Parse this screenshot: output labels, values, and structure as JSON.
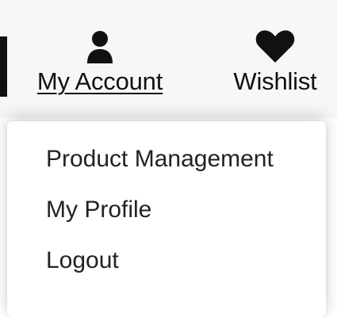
{
  "header": {
    "account": {
      "icon": "user-icon",
      "label": "My Account"
    },
    "wishlist": {
      "icon": "heart-icon",
      "label": "Wishlist"
    }
  },
  "dropdown": {
    "items": [
      {
        "label": "Product Management"
      },
      {
        "label": "My Profile"
      },
      {
        "label": "Logout"
      }
    ]
  },
  "colors": {
    "text": "#111111",
    "header_bg": "#f6f7f9",
    "dropdown_bg": "#ffffff"
  }
}
